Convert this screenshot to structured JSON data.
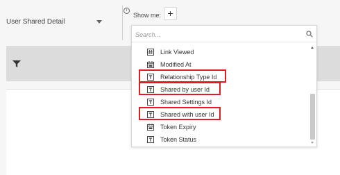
{
  "header": {
    "report_name": "User Shared Detail",
    "info_glyph": "i",
    "show_me_label": "Show me:",
    "add_glyph": "+"
  },
  "search": {
    "placeholder": "Search..."
  },
  "fields": [
    {
      "label": "Link Viewed",
      "icon": "number-icon",
      "highlighted": false
    },
    {
      "label": "Modified At",
      "icon": "date-icon",
      "highlighted": false
    },
    {
      "label": "Relationship Type Id",
      "icon": "text-icon",
      "highlighted": true
    },
    {
      "label": "Shared by user Id",
      "icon": "text-icon",
      "highlighted": true
    },
    {
      "label": "Shared Settings Id",
      "icon": "text-icon",
      "highlighted": false
    },
    {
      "label": "Shared with user Id",
      "icon": "text-icon",
      "highlighted": true
    },
    {
      "label": "Token Expiry",
      "icon": "date-icon",
      "highlighted": false
    },
    {
      "label": "Token Status",
      "icon": "text-icon",
      "highlighted": false
    }
  ],
  "colors": {
    "highlight": "#e01b24",
    "background": "#f6f6f6",
    "band": "#dcdcdc"
  }
}
